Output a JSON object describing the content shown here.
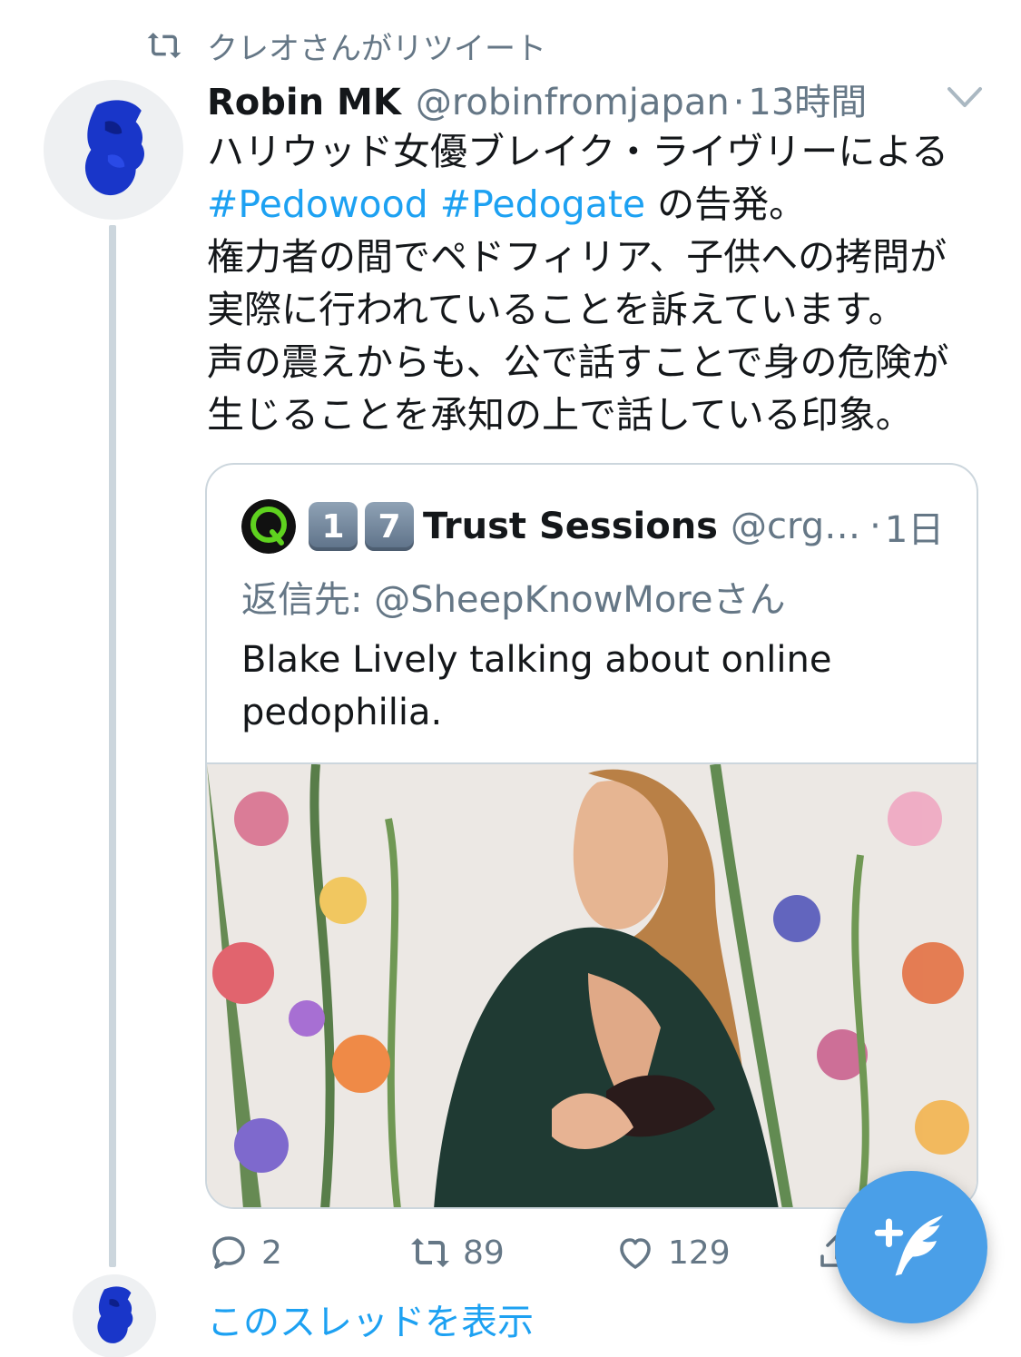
{
  "colors": {
    "accent": "#1da1f2",
    "secondary_text": "#657786",
    "primary_text": "#14171a",
    "border": "#ccd6dd",
    "fab": "#4a9fe8"
  },
  "retweet_header": {
    "icon": "retweet-icon",
    "text": "クレオさんがリツイート"
  },
  "tweet": {
    "display_name": "Robin MK",
    "handle": "@robinfromjapan",
    "separator": "·",
    "time": "13時間",
    "body_lines": [
      "ハリウッド女優ブレイク・ライヴリーによる",
      "権力者の間でペドフィリア、子供への拷問が",
      "実際に行われていることを訴えています。",
      "声の震えからも、公で話すことで身の危険が",
      "生じることを承知の上で話している印象。"
    ],
    "hashtag_1": "#Pedowood",
    "hashtag_2": "#Pedogate",
    "hashtag_suffix": " の告発。"
  },
  "quote": {
    "avatar_icon": "q-logo-icon",
    "keycap_1": "1",
    "keycap_2": "7",
    "display_name": "Trust Sessions",
    "handle": "@crg…",
    "separator": "·",
    "time": "1日",
    "reply_to": "返信先: @SheepKnowMoreさん",
    "text": "Blake Lively talking about online pedophilia."
  },
  "actions": {
    "reply_count": "2",
    "retweet_count": "89",
    "like_count": "129"
  },
  "show_thread": "このスレッドを表示",
  "fab_icon": "compose-tweet-icon"
}
